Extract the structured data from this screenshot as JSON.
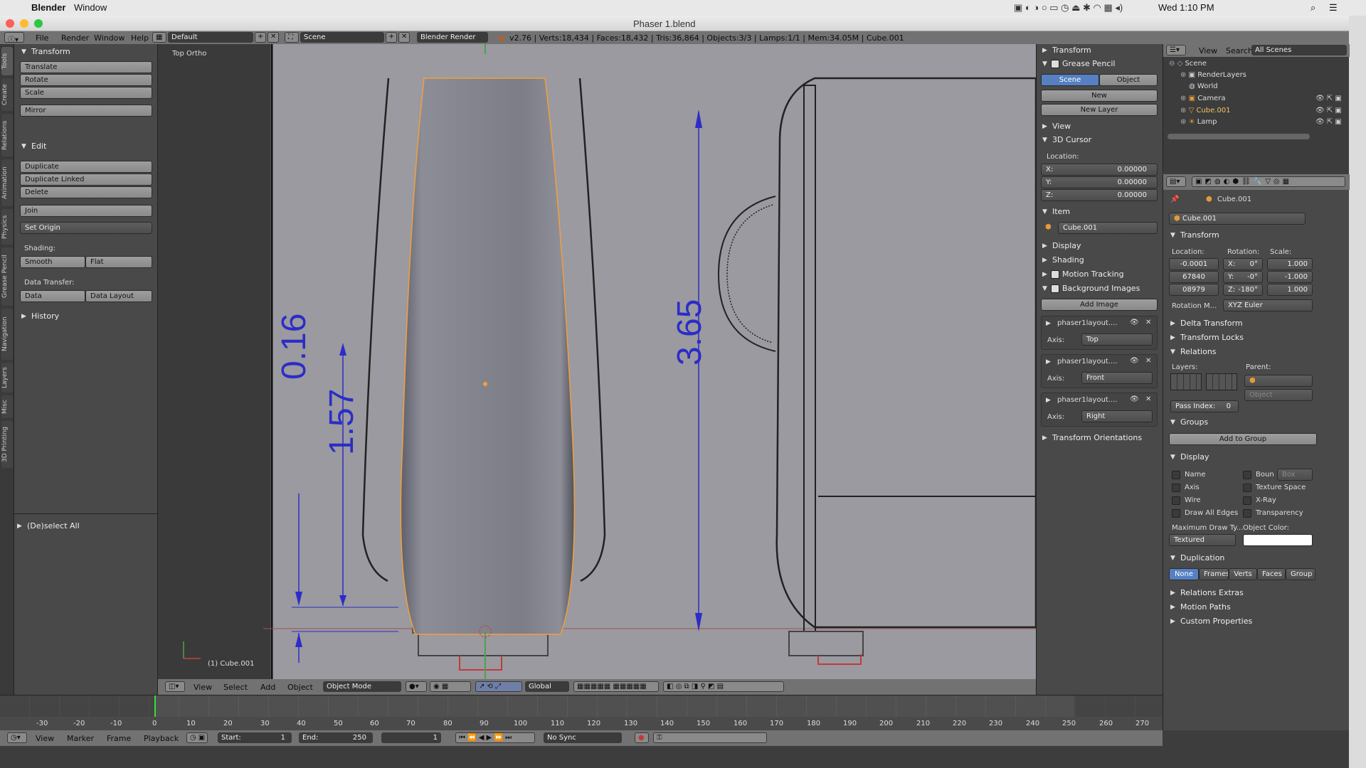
{
  "menubar": {
    "app": "Blender",
    "window": "Window",
    "clock": "Wed 1:10 PM"
  },
  "window": {
    "title": "Phaser 1.blend"
  },
  "info": {
    "menus": [
      "File",
      "Render",
      "Window",
      "Help"
    ],
    "layout": "Default",
    "scene": "Scene",
    "engine": "Blender Render",
    "stats": "v2.76 | Verts:18,434 | Faces:18,432 | Tris:36,864 | Objects:3/3 | Lamps:1/1 | Mem:34.05M | Cube.001"
  },
  "tabs": [
    "Tools",
    "Create",
    "Relations",
    "Animation",
    "Physics",
    "Grease Pencil",
    "Navigation",
    "Layers",
    "Misc",
    "3D Printing"
  ],
  "tools": {
    "transform_title": "Transform",
    "translate": "Translate",
    "rotate": "Rotate",
    "scale": "Scale",
    "mirror": "Mirror",
    "edit_title": "Edit",
    "duplicate": "Duplicate",
    "duplicate_linked": "Duplicate Linked",
    "delete": "Delete",
    "join": "Join",
    "set_origin": "Set Origin",
    "shading_label": "Shading:",
    "smooth": "Smooth",
    "flat": "Flat",
    "data_transfer_label": "Data Transfer:",
    "data": "Data",
    "data_layout": "Data Layout",
    "history_title": "History",
    "operator": "(De)select All"
  },
  "viewport": {
    "view_label": "Top Ortho",
    "object_label": "(1) Cube.001",
    "dim1": "0.16",
    "dim2": "1.57",
    "dim3": "3.65"
  },
  "vphead": {
    "view": "View",
    "select": "Select",
    "add": "Add",
    "object": "Object",
    "mode": "Object Mode",
    "orientation": "Global"
  },
  "npanel": {
    "transform": "Transform",
    "grease_pencil": "Grease Pencil",
    "scene_tab": "Scene",
    "object_tab": "Object",
    "new": "New",
    "new_layer": "New Layer",
    "view": "View",
    "cursor": "3D Cursor",
    "location": "Location:",
    "x": "X:",
    "y": "Y:",
    "z": "Z:",
    "cx": "0.00000",
    "cy": "0.00000",
    "cz": "0.00000",
    "item": "Item",
    "item_name": "Cube.001",
    "display": "Display",
    "shading": "Shading",
    "motion_tracking": "Motion Tracking",
    "background_images": "Background Images",
    "add_image": "Add Image",
    "axis_label": "Axis:",
    "bg_images": [
      {
        "name": "phaser1layout....",
        "axis": "Top"
      },
      {
        "name": "phaser1layout....",
        "axis": "Front"
      },
      {
        "name": "phaser1layout....",
        "axis": "Right"
      }
    ],
    "transform_orientations": "Transform Orientations"
  },
  "outliner": {
    "view": "View",
    "search": "Search",
    "filter": "All Scenes",
    "items": [
      "Scene",
      "RenderLayers",
      "World",
      "Camera",
      "Cube.001",
      "Lamp"
    ]
  },
  "props": {
    "object_path": "Cube.001",
    "object_name": "Cube.001",
    "transform": "Transform",
    "location": "Location:",
    "rotation": "Rotation:",
    "scale": "Scale:",
    "loc": [
      "-0.0001",
      "67840",
      "08979"
    ],
    "rot_x": "X:",
    "rot_y": "Y:",
    "rot_z": "Z:",
    "rot": [
      "0°",
      "-0°",
      "-180°"
    ],
    "scl": [
      "1.000",
      "-1.000",
      "1.000"
    ],
    "rotation_mode_label": "Rotation M...",
    "rotation_mode": "XYZ Euler",
    "delta_transform": "Delta Transform",
    "transform_locks": "Transform Locks",
    "relations": "Relations",
    "layers": "Layers:",
    "parent": "Parent:",
    "parent_type": "Object",
    "pass_index": "Pass Index:",
    "pass_val": "0",
    "groups": "Groups",
    "add_to_group": "Add to Group",
    "display": "Display",
    "name": "Name",
    "bounds": "Boun",
    "bounds_type": "Box",
    "axis": "Axis",
    "texture_space": "Texture Space",
    "wire": "Wire",
    "xray": "X-Ray",
    "draw_all_edges": "Draw All Edges",
    "transparency": "Transparency",
    "max_draw_type": "Maximum Draw Ty...",
    "object_color": "Object Color:",
    "draw_type": "Textured",
    "duplication": "Duplication",
    "dup_options": [
      "None",
      "Frames",
      "Verts",
      "Faces",
      "Group"
    ],
    "relations_extras": "Relations Extras",
    "motion_paths": "Motion Paths",
    "custom_properties": "Custom Properties"
  },
  "timeline": {
    "ticks": [
      "-30",
      "-20",
      "-10",
      "0",
      "10",
      "20",
      "30",
      "40",
      "50",
      "60",
      "70",
      "80",
      "90",
      "100",
      "110",
      "120",
      "130",
      "140",
      "150",
      "160",
      "170",
      "180",
      "190",
      "200",
      "210",
      "220",
      "230",
      "240",
      "250",
      "260",
      "270"
    ],
    "view": "View",
    "marker": "Marker",
    "frame": "Frame",
    "playback": "Playback",
    "start_label": "Start:",
    "start": "1",
    "end_label": "End:",
    "end": "250",
    "current": "1",
    "sync": "No Sync"
  },
  "colors": {
    "selected_outline": "#f2a03c",
    "blue_accent": "#5680c2",
    "drawing_blue": "#2c2cc8"
  }
}
